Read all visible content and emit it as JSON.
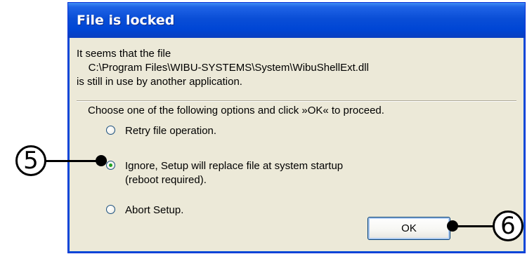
{
  "dialog": {
    "title": "File is locked",
    "message": "It seems that the file\n    C:\\Program Files\\WIBU-SYSTEMS\\System\\WibuShellExt.dll\nis still in use by another application.",
    "instruction": "Choose one of the following options and click »OK« to proceed.",
    "options": [
      {
        "label": "Retry file operation.",
        "selected": false
      },
      {
        "label": "Ignore, Setup will replace file at system startup\n(reboot required).",
        "selected": true
      },
      {
        "label": "Abort Setup.",
        "selected": false
      }
    ],
    "ok_label": "OK"
  },
  "callouts": {
    "first": "5",
    "second": "6"
  }
}
